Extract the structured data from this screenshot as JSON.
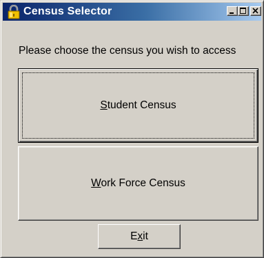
{
  "window": {
    "title": "Census Selector",
    "icon": "lock-icon",
    "controls": [
      "minimize-icon",
      "maximize-icon",
      "close-icon"
    ]
  },
  "prompt": "Please choose the census you wish to access",
  "buttons": {
    "student": {
      "mnemonic": "S",
      "rest": "tudent Census"
    },
    "workforce": {
      "mnemonic": "W",
      "rest": "ork Force Census"
    },
    "exit": {
      "before": "E",
      "mnemonic": "x",
      "after": "it"
    }
  },
  "colors": {
    "face": "#d4d0c8",
    "title_start": "#0a246a",
    "title_end": "#a6caf0"
  }
}
